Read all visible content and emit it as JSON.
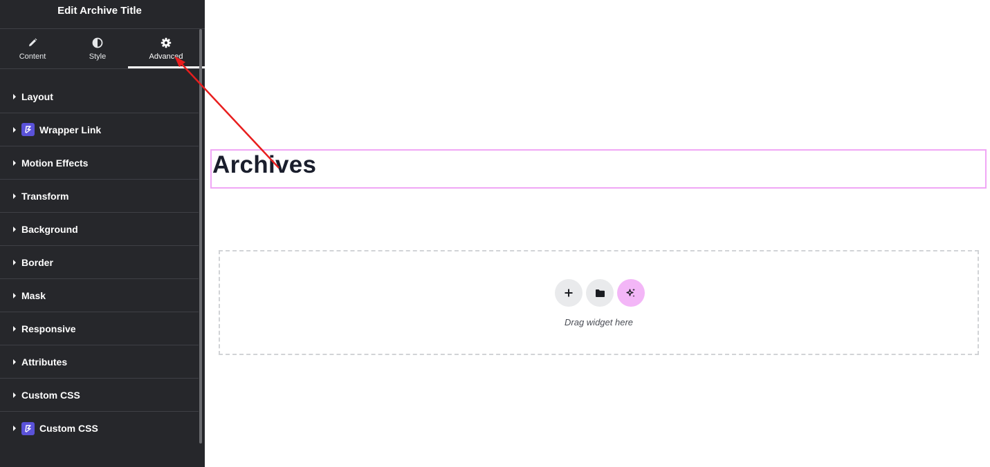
{
  "panel": {
    "title": "Edit Archive Title",
    "tabs": [
      {
        "label": "Content",
        "icon": "pencil-icon"
      },
      {
        "label": "Style",
        "icon": "half-circle-icon"
      },
      {
        "label": "Advanced",
        "icon": "gear-icon",
        "active": true
      }
    ],
    "sections": [
      {
        "label": "Layout"
      },
      {
        "label": "Wrapper Link",
        "pro": true
      },
      {
        "label": "Motion Effects"
      },
      {
        "label": "Transform"
      },
      {
        "label": "Background"
      },
      {
        "label": "Border"
      },
      {
        "label": "Mask"
      },
      {
        "label": "Responsive"
      },
      {
        "label": "Attributes"
      },
      {
        "label": "Custom CSS"
      },
      {
        "label": "Custom CSS",
        "pro": true
      }
    ]
  },
  "canvas": {
    "title_widget": {
      "text": "Archives"
    },
    "dropzone": {
      "buttons": [
        "plus-icon",
        "folder-icon",
        "ai-sparkle-icon"
      ],
      "text": "Drag widget here"
    }
  },
  "colors": {
    "panel_bg": "#26272b",
    "selection_border": "#f0a6f5",
    "pro_badge": "#5a52d9",
    "ai_button": "#f3b6f7",
    "annotation_arrow": "#e81e1e"
  }
}
